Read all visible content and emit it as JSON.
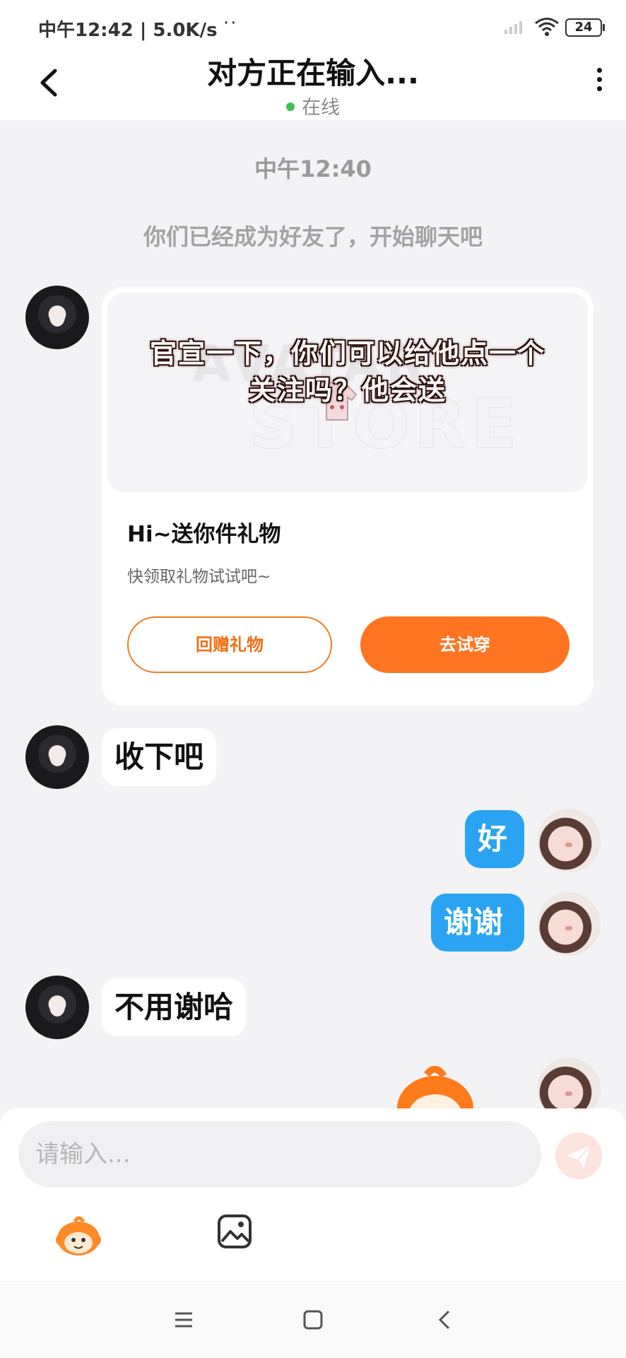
{
  "status_bar": {
    "time_speed": "中午12:42 | 5.0K/s",
    "dots": "··",
    "battery": "24"
  },
  "header": {
    "title": "对方正在输入...",
    "online_label": "在线"
  },
  "system": {
    "timestamp": "中午12:40",
    "friend_note": "你们已经成为好友了，开始聊天吧"
  },
  "gift_card": {
    "banner_overlay_line1": "官宣一下，你们可以给他点一个",
    "banner_overlay_line2": "关注吗？他会送",
    "title": "Hi~送你件礼物",
    "subtitle": "快领取礼物试试吧~",
    "return_gift_label": "回赠礼物",
    "try_on_label": "去试穿"
  },
  "messages": [
    {
      "side": "left",
      "text": "收下吧"
    },
    {
      "side": "right",
      "text": "好"
    },
    {
      "side": "right",
      "text": "谢谢"
    },
    {
      "side": "left",
      "text": "不用谢哈"
    }
  ],
  "composer": {
    "placeholder": "请输入...",
    "value": ""
  },
  "colors": {
    "accent_orange": "#ff7420",
    "bubble_blue": "#2aa4f2",
    "online_green": "#3bc24f"
  }
}
